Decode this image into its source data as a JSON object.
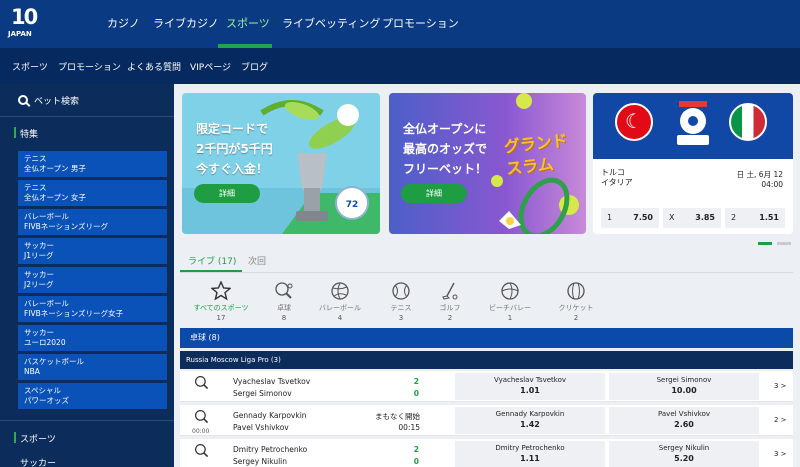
{
  "brand": {
    "logo_main": "10",
    "logo_sub": "JAPAN"
  },
  "topnav": {
    "items": [
      "カジノ",
      "ライブカジノ",
      "スポーツ",
      "ライブベッティング",
      "プロモーション"
    ],
    "active_index": 2
  },
  "subnav": {
    "items": [
      "スポーツ",
      "プロモーション",
      "よくある質問",
      "VIPページ",
      "ブログ"
    ]
  },
  "sidebar": {
    "search_label": "ベット検索",
    "featured_title": "特集",
    "featured": [
      {
        "line1": "テニス",
        "line2": "全仏オープン 男子"
      },
      {
        "line1": "テニス",
        "line2": "全仏オープン 女子"
      },
      {
        "line1": "バレーボール",
        "line2": "FIVBネーションズリーグ"
      },
      {
        "line1": "サッカー",
        "line2": "J1リーグ"
      },
      {
        "line1": "サッカー",
        "line2": "J2リーグ"
      },
      {
        "line1": "バレーボール",
        "line2": "FIVBネーションズリーグ女子"
      },
      {
        "line1": "サッカー",
        "line2": "ユーロ2020"
      },
      {
        "line1": "バスケットボール",
        "line2": "NBA"
      },
      {
        "line1": "スペシャル",
        "line2": "パワーオッズ"
      }
    ],
    "sports_title": "スポーツ",
    "sports_first": "サッカー"
  },
  "banners": [
    {
      "lines": [
        "限定コードで",
        "2千円が5千円",
        "今すぐ入金！"
      ],
      "button": "詳細",
      "badge": "EURO 2020"
    },
    {
      "lines": [
        "全仏オープンに",
        "最高のオッズで",
        "フリーベット！"
      ],
      "button": "詳細",
      "art_text": [
        "グランド",
        "スラム"
      ]
    }
  ],
  "match_card": {
    "badge": "EURO 2020",
    "home": "トルコ",
    "away": "イタリア",
    "date": "日 土, 6月 12",
    "time": "04:00",
    "odds": [
      {
        "k": "1",
        "v": "7.50"
      },
      {
        "k": "X",
        "v": "3.85"
      },
      {
        "k": "2",
        "v": "1.51"
      }
    ]
  },
  "tabs": {
    "live": "ライブ (17)",
    "next": "次回"
  },
  "categories": [
    {
      "name": "すべてのスポーツ",
      "count": "17",
      "icon": "star-icon"
    },
    {
      "name": "卓球",
      "count": "8",
      "icon": "table-tennis-icon"
    },
    {
      "name": "バレーボール",
      "count": "4",
      "icon": "volleyball-icon"
    },
    {
      "name": "テニス",
      "count": "3",
      "icon": "tennis-ball-icon"
    },
    {
      "name": "ゴルフ",
      "count": "2",
      "icon": "golf-icon"
    },
    {
      "name": "ビーチバレー",
      "count": "1",
      "icon": "beach-volleyball-icon"
    },
    {
      "name": "クリケット",
      "count": "2",
      "icon": "cricket-ball-icon"
    }
  ],
  "section": {
    "title": "卓球 (8)"
  },
  "league": {
    "title": "Russia Moscow Liga Pro (3)"
  },
  "matches": [
    {
      "p1": "Vyacheslav Tsvetkov",
      "p2": "Sergei Simonov",
      "s1": "2",
      "s2": "0",
      "status": "",
      "time": "",
      "o1": {
        "name": "Vyacheslav Tsvetkov",
        "odd": "1.01"
      },
      "o2": {
        "name": "Sergei Simonov",
        "odd": "10.00"
      },
      "more": "3 >"
    },
    {
      "p1": "Gennady Karpovkin",
      "p2": "Pavel Vshivkov",
      "s1": "",
      "s2": "",
      "status": "まもなく開始",
      "status_time": "00:15",
      "time": "00:00",
      "o1": {
        "name": "Gennady Karpovkin",
        "odd": "1.42"
      },
      "o2": {
        "name": "Pavel Vshivkov",
        "odd": "2.60"
      },
      "more": "2 >"
    },
    {
      "p1": "Dmitry Petrochenko",
      "p2": "Sergey Nikulin",
      "s1": "2",
      "s2": "0",
      "status": "",
      "time": "",
      "o1": {
        "name": "Dmitry Petrochenko",
        "odd": "1.11"
      },
      "o2": {
        "name": "Sergey Nikulin",
        "odd": "5.20"
      },
      "more": "3 >"
    }
  ]
}
